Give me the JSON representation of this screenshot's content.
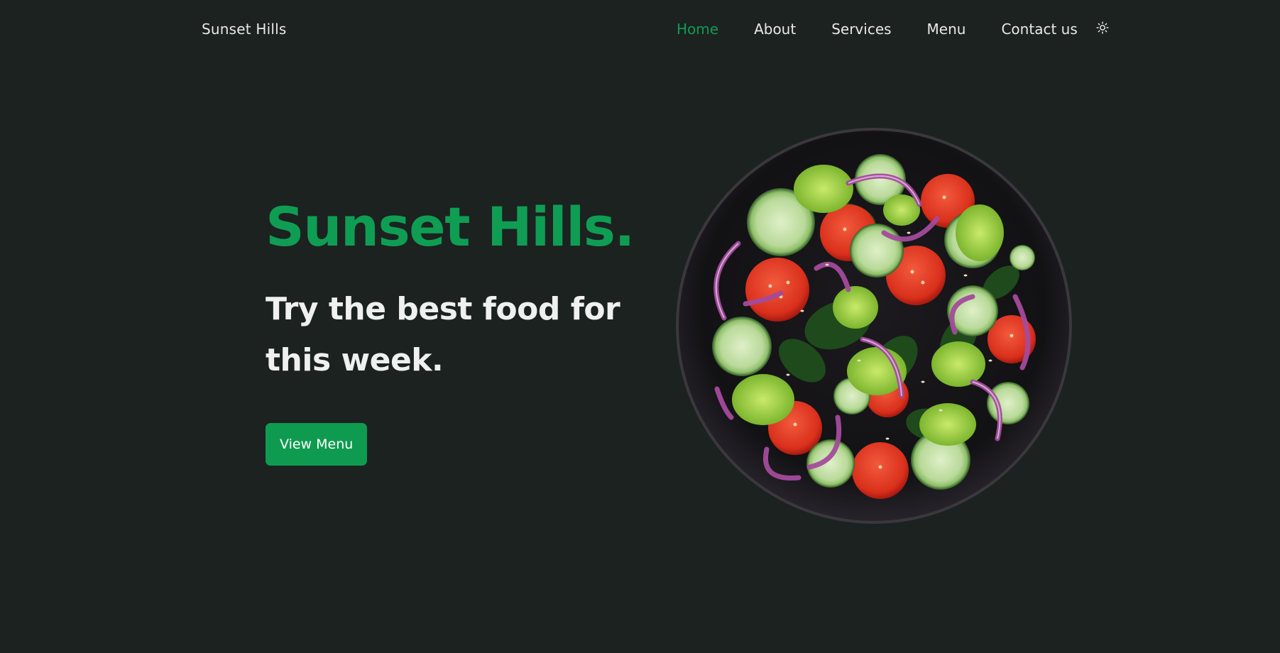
{
  "header": {
    "brand": "Sunset Hills",
    "nav": [
      "Home",
      "About",
      "Services",
      "Menu",
      "Contact us"
    ],
    "active": "Home",
    "theme_icon": "sun-icon"
  },
  "hero": {
    "title": "Sunset Hills.",
    "subtitle": "Try the best food for this week.",
    "cta_label": "View Menu",
    "image": "salad-bowl-image"
  },
  "colors": {
    "background": "#1b2220",
    "accent": "#0f9d54",
    "text": "#e8ece9"
  }
}
